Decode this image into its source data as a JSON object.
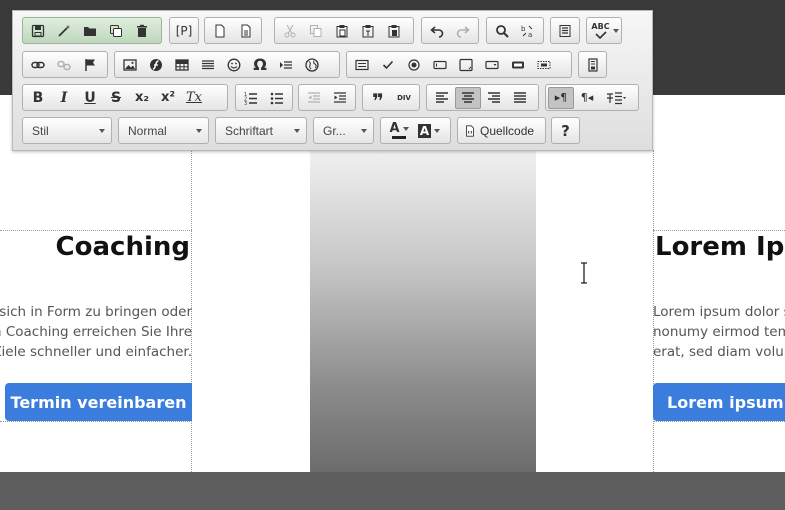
{
  "left_card": {
    "title": "Coaching",
    "lines": [
      "sich in Form zu bringen oder",
      "m Coaching erreichen Sie Ihre",
      "Ziele schneller und einfacher."
    ],
    "button": "Termin vereinbaren"
  },
  "right_card": {
    "title": "Lorem Ipsum",
    "lines": [
      "Lorem ipsum dolor sit amet",
      "nonumy eirmod tempor",
      "erat, sed diam voluptua."
    ],
    "button": "Lorem ipsum"
  },
  "toolbar": {
    "row1": {
      "document": [
        "save-icon",
        "magic-wand-icon",
        "folder-icon",
        "copy-formatting-icon",
        "trash-icon"
      ],
      "preview_label": "[P]",
      "templates": [
        "new-page-icon",
        "document-icon"
      ],
      "clipboard": [
        "cut-icon",
        "copy-icon",
        "paste-icon",
        "paste-text-icon",
        "paste-word-icon"
      ],
      "history": [
        "undo-icon",
        "redo-icon"
      ],
      "find": [
        "search-icon",
        "replace-icon"
      ],
      "select_all": "select-all-icon",
      "spellcheck_label": "ABC"
    },
    "format_labels": {
      "bold": "B",
      "italic": "I",
      "underline": "U",
      "strike": "S",
      "subscript": "x₂",
      "superscript": "x²",
      "remove_format": "Tx",
      "blockquote": "❞",
      "div": "DIV",
      "ltr": "▸¶",
      "rtl": "¶◂"
    },
    "combos": {
      "style": "Stil",
      "format": "Normal",
      "font": "Schriftart",
      "size": "Gr...",
      "source": "Quellcode",
      "help": "?",
      "text_color": "A",
      "bg_color": "A"
    }
  },
  "colors": {
    "button_blue": "#3b7ddd",
    "top_bar": "#3a3a3a",
    "bottom_bar": "#5e5e5e"
  }
}
